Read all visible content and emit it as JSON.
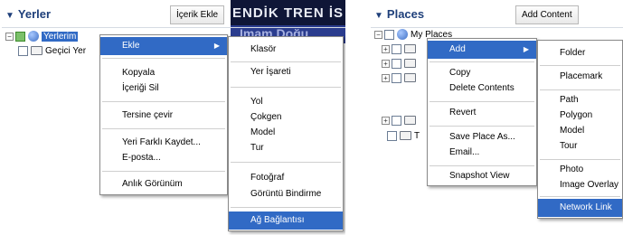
{
  "turkish": {
    "header": {
      "title": "Yerler",
      "add_content": "İçerik Ekle"
    },
    "tree": {
      "root": "Yerlerim",
      "temp": "Geçici Yer"
    },
    "banner": {
      "line1": "ENDİK TREN İS",
      "line2": "Imam Doğu"
    },
    "context_menu": {
      "add": "Ekle",
      "copy": "Kopyala",
      "delete_contents": "İçeriği Sil",
      "revert": "Tersine çevir",
      "save_place_as": "Yeri Farklı Kaydet...",
      "email": "E-posta...",
      "snapshot_view": "Anlık Görünüm"
    },
    "submenu": {
      "folder": "Klasör",
      "placemark": "Yer İşareti",
      "path": "Yol",
      "polygon": "Çokgen",
      "model": "Model",
      "tour": "Tur",
      "photo": "Fotoğraf",
      "image_overlay": "Görüntü Bindirme",
      "network_link": "Ağ Bağlantısı"
    }
  },
  "english": {
    "header": {
      "title": "Places",
      "add_content": "Add Content"
    },
    "tree": {
      "root": "My Places",
      "temp": "T"
    },
    "context_menu": {
      "add": "Add",
      "copy": "Copy",
      "delete_contents": "Delete Contents",
      "revert": "Revert",
      "save_place_as": "Save Place As...",
      "email": "Email...",
      "snapshot_view": "Snapshot View"
    },
    "submenu": {
      "folder": "Folder",
      "placemark": "Placemark",
      "path": "Path",
      "polygon": "Polygon",
      "model": "Model",
      "tour": "Tour",
      "photo": "Photo",
      "image_overlay": "Image Overlay",
      "network_link": "Network Link"
    }
  },
  "colors": {
    "highlight": "#316ac5",
    "header_text": "#1e3f7a",
    "banner_bg": "#0f1637"
  }
}
